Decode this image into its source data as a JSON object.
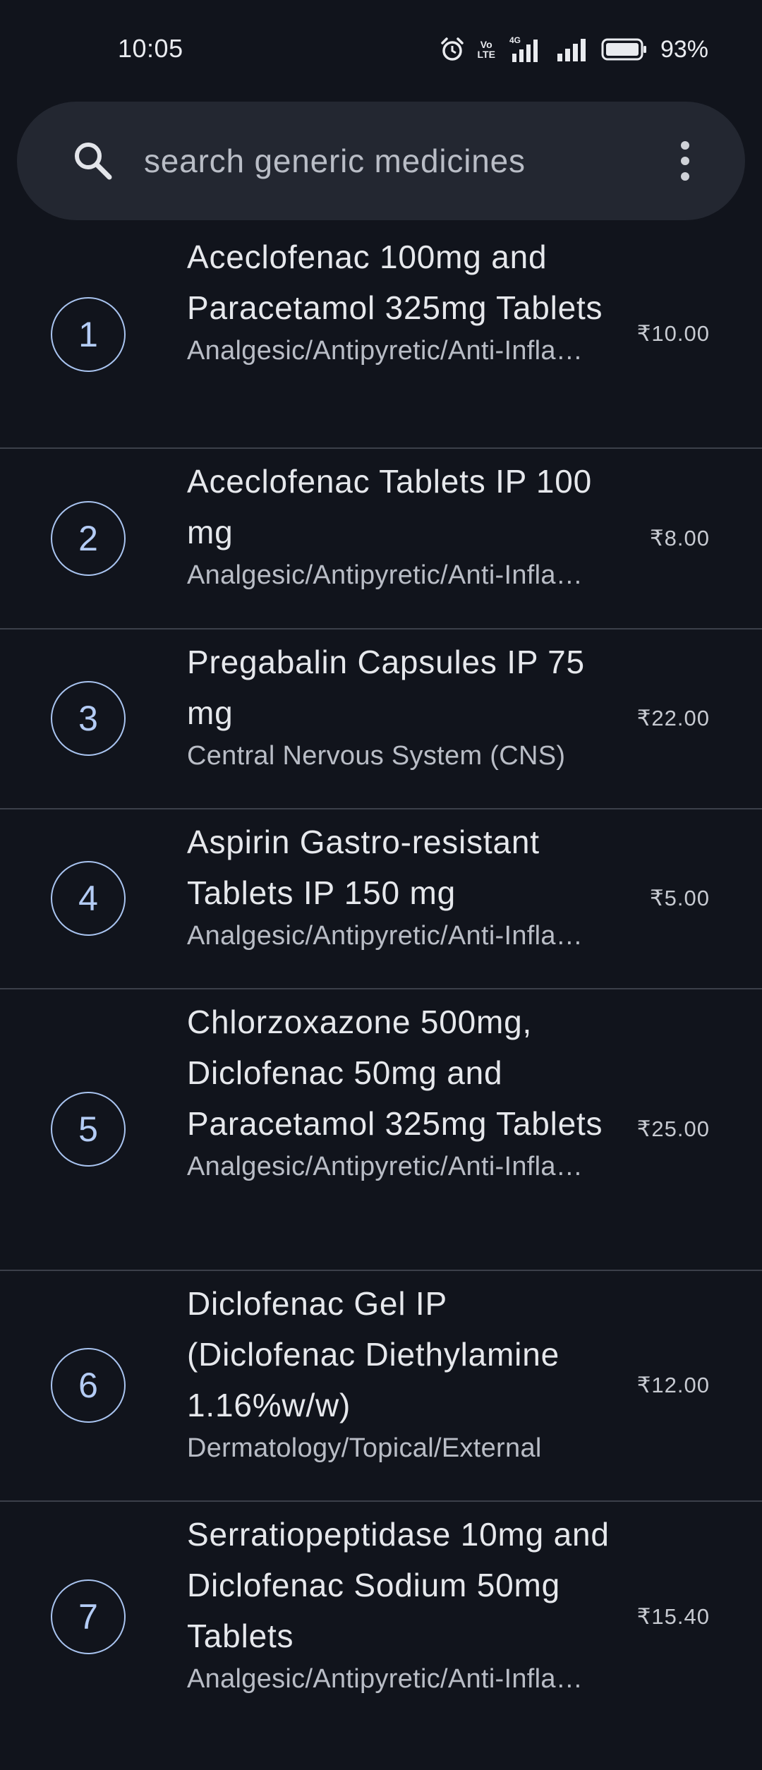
{
  "status_bar": {
    "time": "10:05",
    "battery_percent": "93%",
    "network": "4G",
    "volte_top": "Vo",
    "volte_bottom": "LTE",
    "icons": [
      "alarm-icon",
      "volte-icon",
      "signal-4g-icon",
      "signal-icon",
      "battery-icon"
    ]
  },
  "search": {
    "placeholder": "search generic medicines",
    "value": ""
  },
  "colors": {
    "background": "#11141c",
    "search_bg": "#232731",
    "accent": "#a9c4f0",
    "divider": "#3c404a"
  },
  "medicines": [
    {
      "index": "1",
      "name": "Aceclofenac 100mg and Paracetamol 325mg Tablets",
      "category": "Analgesic/Antipyretic/Anti-Inflammatory",
      "price": "₹10.00"
    },
    {
      "index": "2",
      "name": "Aceclofenac Tablets IP 100 mg",
      "category": "Analgesic/Antipyretic/Anti-Inflammatory",
      "price": "₹8.00"
    },
    {
      "index": "3",
      "name": "Pregabalin Capsules IP 75 mg",
      "category": "Central Nervous System (CNS)",
      "price": "₹22.00"
    },
    {
      "index": "4",
      "name": "Aspirin Gastro-resistant Tablets IP 150 mg",
      "category": "Analgesic/Antipyretic/Anti-Inflammatory",
      "price": "₹5.00"
    },
    {
      "index": "5",
      "name": "Chlorzoxazone 500mg, Diclofenac 50mg and Paracetamol 325mg Tablets",
      "category": "Analgesic/Antipyretic/Anti-Inflammatory",
      "price": "₹25.00"
    },
    {
      "index": "6",
      "name": "Diclofenac Gel IP (Diclofenac Diethylamine 1.16%w/w)",
      "category": "Dermatology/Topical/External",
      "price": "₹12.00"
    },
    {
      "index": "7",
      "name": "Serratiopeptidase 10mg and Diclofenac Sodium 50mg Tablets",
      "category": "Analgesic/Antipyretic/Anti-Inflammatory",
      "price": "₹15.40"
    }
  ]
}
